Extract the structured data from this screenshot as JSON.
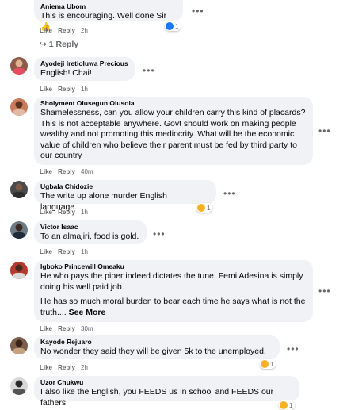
{
  "comments": [
    {
      "name": "Aniema Ubom",
      "text": "This is encouraging. Well done Sir 👍",
      "like": "Like",
      "reply": "Reply",
      "time": "2h",
      "reactions": "1",
      "replies_label": "1 Reply"
    },
    {
      "name": "Ayodeji Iretioluwa Precious",
      "text": "English! Chai!",
      "like": "Like",
      "reply": "Reply",
      "time": "1h"
    },
    {
      "name": "Sholyment Olusegun Olusola",
      "text": "Shamelessness, can you allow your children carry this kind of placards? This is not acceptable anywhere. Govt should work on making people wealthy and not promoting this mediocrity. What will be the economic value of children who believe their parent must be fed by third party to our country",
      "like": "Like",
      "reply": "Reply",
      "time": "40m"
    },
    {
      "name": "Ugbala Chidozie",
      "text": "The write up alone murder English language...",
      "like": "Like",
      "reply": "Reply",
      "time": "1h",
      "reactions": "1"
    },
    {
      "name": "Victor Isaac",
      "text": "To an almajiri, food is gold.",
      "like": "Like",
      "reply": "Reply",
      "time": "1h"
    },
    {
      "name": "Igboko Princewill Omeaku",
      "text": "He who pays the piper indeed dictates the tune. Femi Adesina is simply doing his well paid job.",
      "text2": "He has so much moral burden to bear each time he says what is not the truth....",
      "see_more": "See More",
      "like": "Like",
      "reply": "Reply",
      "time": "30m"
    },
    {
      "name": "Kayode Rejuaro",
      "text": "No wonder they said they will be given 5k to the unemployed.",
      "like": "Like",
      "reply": "Reply",
      "time": "2h",
      "reactions": "1"
    },
    {
      "name": "Uzor Chukwu",
      "text": "I also like the English, you FEEDS us in school and FEEDS our fathers",
      "reactions": "1"
    }
  ],
  "menu_glyph": "•••",
  "colors": {
    "bubble": "#f0f2f5",
    "meta": "#65676b",
    "like": "#1877f2",
    "haha": "#f7b125"
  }
}
